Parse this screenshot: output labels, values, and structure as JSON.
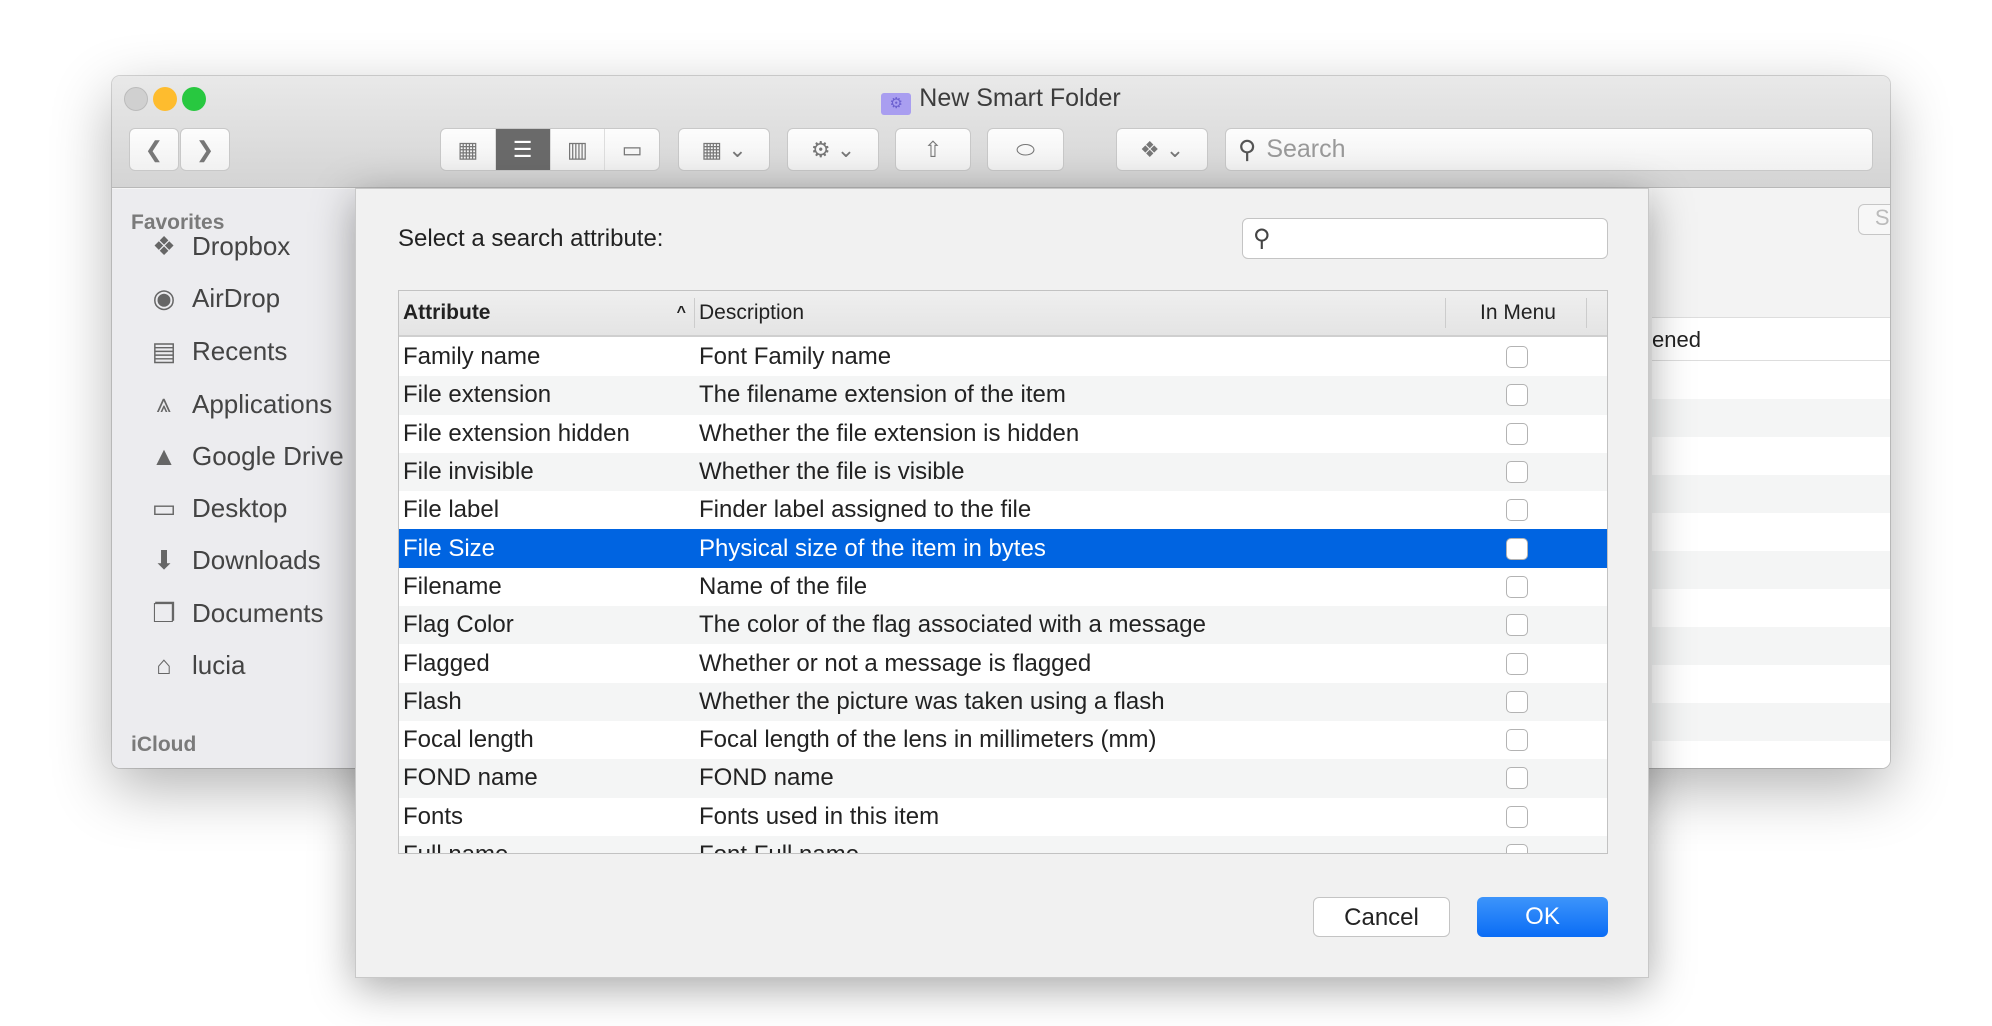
{
  "window": {
    "title": "New Smart Folder",
    "search_placeholder": "Search"
  },
  "sidebar": {
    "favorites_label": "Favorites",
    "icloud_label": "iCloud",
    "items": [
      {
        "label": "Dropbox",
        "icon": "dropbox-icon"
      },
      {
        "label": "AirDrop",
        "icon": "airdrop-icon"
      },
      {
        "label": "Recents",
        "icon": "recents-icon"
      },
      {
        "label": "Applications",
        "icon": "applications-icon"
      },
      {
        "label": "Google Drive",
        "icon": "google-drive-icon"
      },
      {
        "label": "Desktop",
        "icon": "desktop-icon"
      },
      {
        "label": "Downloads",
        "icon": "downloads-icon"
      },
      {
        "label": "Documents",
        "icon": "documents-icon"
      },
      {
        "label": "lucia",
        "icon": "home-icon"
      }
    ]
  },
  "right_panel": {
    "save_label": "Save",
    "column_partial": "ened"
  },
  "dialog": {
    "prompt": "Select a search attribute:",
    "search_value": "",
    "columns": {
      "attribute": "Attribute",
      "description": "Description",
      "in_menu": "In Menu"
    },
    "rows": [
      {
        "attribute": "Family name",
        "description": "Font Family name",
        "in_menu": false
      },
      {
        "attribute": "File extension",
        "description": "The filename extension of the item",
        "in_menu": false
      },
      {
        "attribute": "File extension hidden",
        "description": "Whether the file extension is hidden",
        "in_menu": false
      },
      {
        "attribute": "File invisible",
        "description": "Whether the file is visible",
        "in_menu": false
      },
      {
        "attribute": "File label",
        "description": "Finder label assigned to the file",
        "in_menu": false
      },
      {
        "attribute": "File Size",
        "description": "Physical size of the item in bytes",
        "in_menu": false,
        "selected": true
      },
      {
        "attribute": "Filename",
        "description": "Name of the file",
        "in_menu": false
      },
      {
        "attribute": "Flag Color",
        "description": "The color of the flag associated with a message",
        "in_menu": false
      },
      {
        "attribute": "Flagged",
        "description": "Whether or not a message is flagged",
        "in_menu": false
      },
      {
        "attribute": "Flash",
        "description": "Whether the picture was taken using a flash",
        "in_menu": false
      },
      {
        "attribute": "Focal length",
        "description": "Focal length of the lens in millimeters (mm)",
        "in_menu": false
      },
      {
        "attribute": "FOND name",
        "description": "FOND name",
        "in_menu": false
      },
      {
        "attribute": "Fonts",
        "description": "Fonts used in this item",
        "in_menu": false
      },
      {
        "attribute": "Full name",
        "description": "Font Full name",
        "in_menu": false
      }
    ],
    "cancel_label": "Cancel",
    "ok_label": "OK"
  },
  "colors": {
    "selection": "#0064e1",
    "ok_button": "#1a7cf5"
  }
}
